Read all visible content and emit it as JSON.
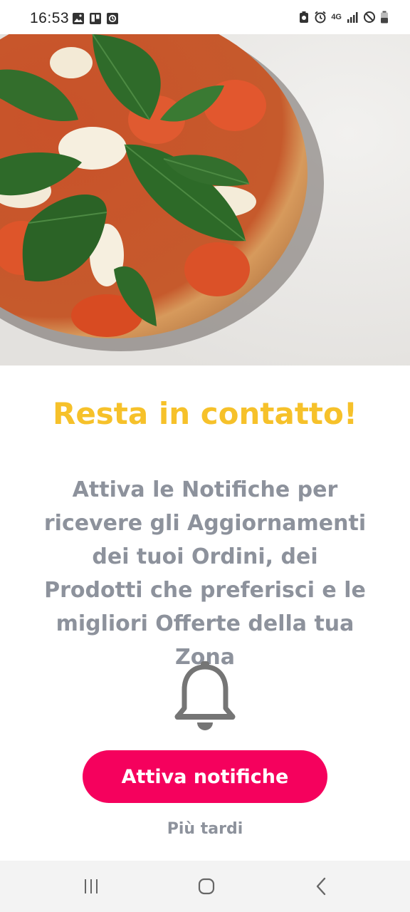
{
  "status_bar": {
    "time": "16:53",
    "network": "4G"
  },
  "colors": {
    "title": "#f6c12a",
    "text": "#8d929c",
    "primary_button": "#f5015d",
    "bell": "#757575"
  },
  "hero": {
    "image": "pizza-margherita-photo"
  },
  "content": {
    "title": "Resta in contatto!",
    "description": "Attiva le Notifiche per ricevere gli Aggiornamenti dei tuoi Ordini, dei Prodotti che preferisci e le migliori Offerte della tua Zona",
    "icon": "bell-icon"
  },
  "actions": {
    "enable_label": "Attiva notifiche",
    "later_label": "Più tardi"
  },
  "navigation": {
    "recents": "recent-apps-icon",
    "home": "home-icon",
    "back": "back-icon"
  }
}
